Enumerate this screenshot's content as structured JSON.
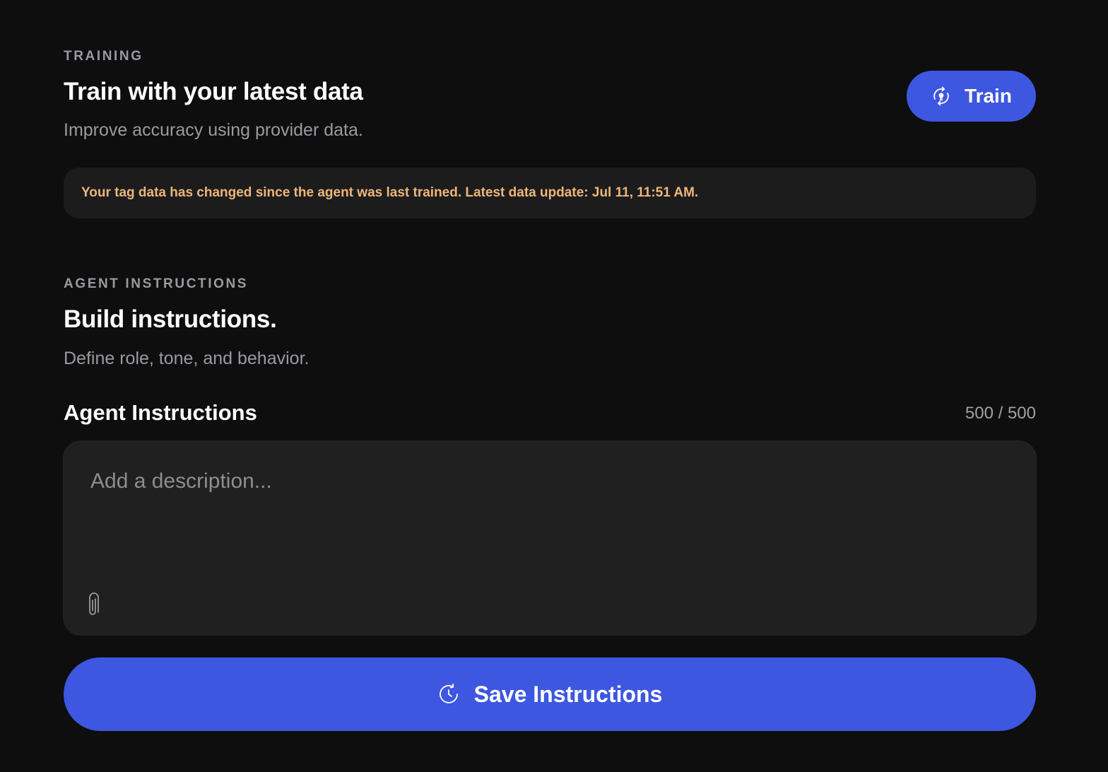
{
  "training": {
    "eyebrow": "TRAINING",
    "title": "Train with your latest data",
    "subtitle": "Improve accuracy using provider data.",
    "train_button": {
      "label": "Train",
      "icon": "refresh-bulb-icon"
    },
    "notice": "Your tag data has changed since the agent was last trained. Latest data update: Jul 11, 11:51 AM."
  },
  "instructions": {
    "eyebrow": "AGENT INSTRUCTIONS",
    "title": "Build instructions.",
    "subtitle": "Define role, tone, and behavior.",
    "field_label": "Agent Instructions",
    "char_count": "500 / 500",
    "textarea": {
      "value": "",
      "placeholder": "Add a description..."
    },
    "attach_icon": "paperclip-icon",
    "save_button": {
      "label": "Save Instructions",
      "icon": "clock-refresh-icon"
    }
  },
  "colors": {
    "background": "#0e0e0f",
    "accent": "#3d57e0",
    "warning_text": "#efb57a",
    "muted_text": "#9a9aa0",
    "panel": "#1c1c1d"
  }
}
